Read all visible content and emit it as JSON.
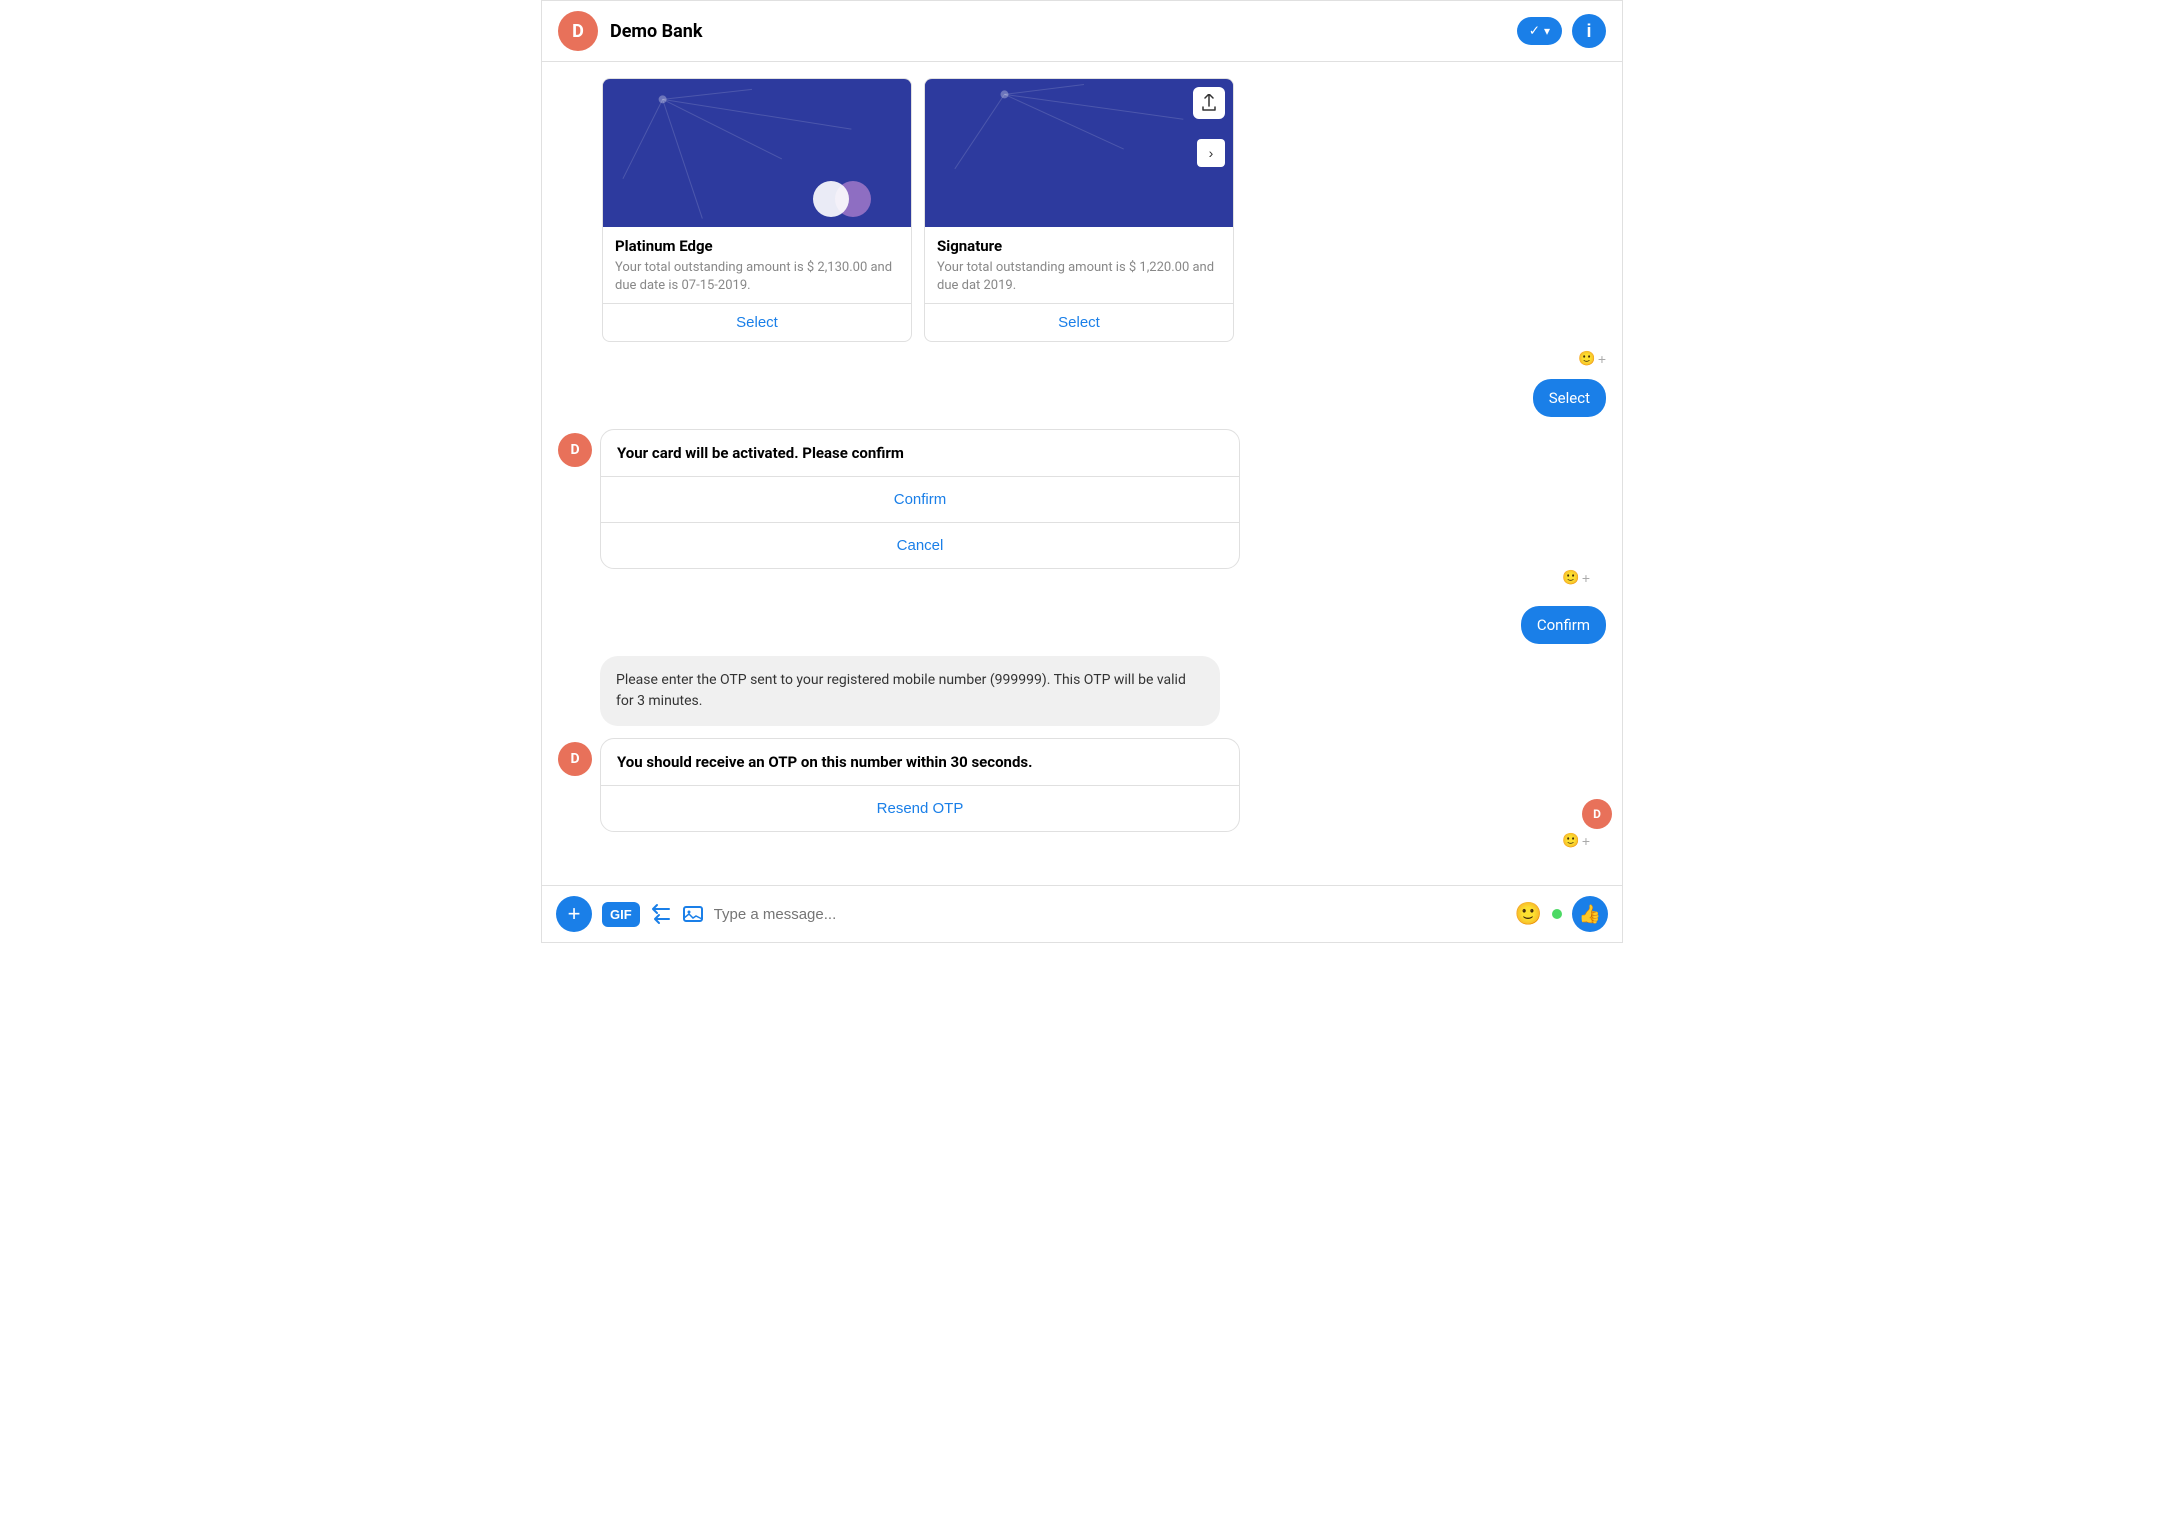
{
  "header": {
    "avatar_letter": "D",
    "title": "Demo Bank",
    "check_icon": "✓",
    "chevron_icon": "›",
    "info_icon": "i"
  },
  "cards": [
    {
      "name": "Platinum Edge",
      "desc": "Your total outstanding amount is $ 2,130.00 and due date is 07-15-2019.",
      "select_label": "Select"
    },
    {
      "name": "Signature",
      "desc": "Your total outstanding amount is $ 1,220.00 and due dat 2019.",
      "select_label": "Select"
    }
  ],
  "user_select_bubble": "Select",
  "confirm_card": {
    "header": "Your card will be activated. Please confirm",
    "confirm_label": "Confirm",
    "cancel_label": "Cancel"
  },
  "user_confirm_bubble": "Confirm",
  "otp_message": "Please enter the OTP sent to your registered mobile number (999999). This OTP will be valid for 3 minutes.",
  "otp_card": {
    "header": "You should receive an OTP on this number within 30 seconds.",
    "resend_label": "Resend OTP"
  },
  "bottom_bar": {
    "gif_label": "GIF",
    "input_placeholder": "Type a message...",
    "add_icon": "+",
    "thumb_icon": "👍"
  }
}
